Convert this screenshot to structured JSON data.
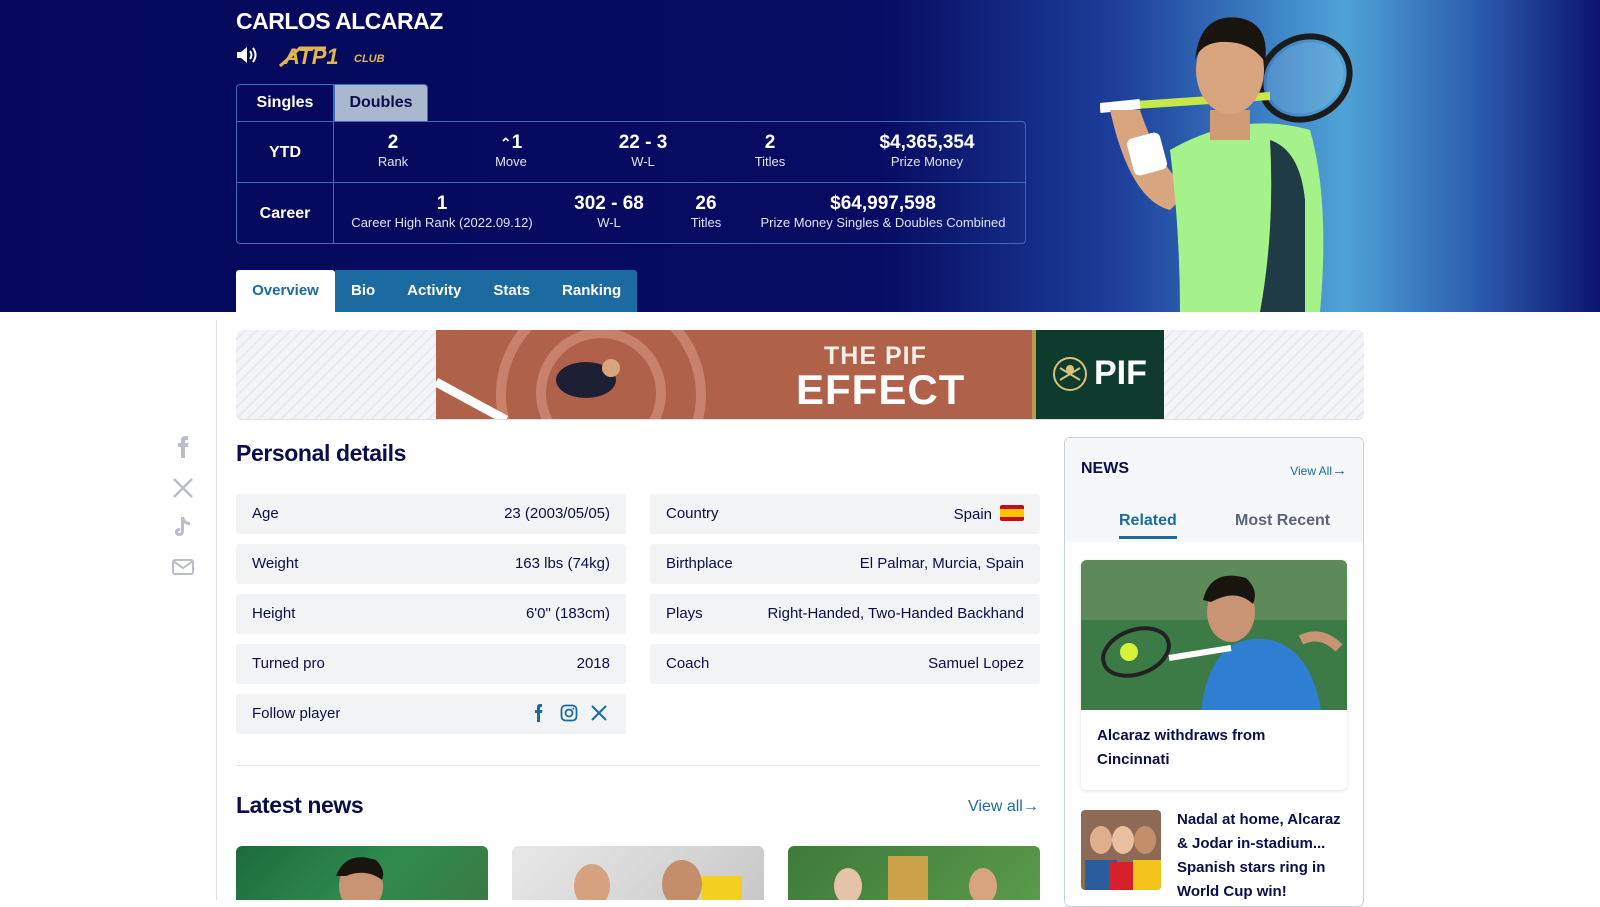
{
  "player": {
    "name": "CARLOS ALCARAZ",
    "badge": "ATP1",
    "badge_suffix": "CLUB"
  },
  "rank_tabs": [
    "Singles",
    "Doubles"
  ],
  "ytd": {
    "label": "YTD",
    "rank": {
      "value": "2",
      "label": "Rank"
    },
    "move": {
      "value": "1",
      "label": "Move"
    },
    "wl": {
      "value": "22 - 3",
      "label": "W-L"
    },
    "titles": {
      "value": "2",
      "label": "Titles"
    },
    "prize": {
      "value": "$4,365,354",
      "label": "Prize Money"
    }
  },
  "career": {
    "label": "Career",
    "high": {
      "value": "1",
      "label": "Career High Rank (2022.09.12)"
    },
    "wl": {
      "value": "302 - 68",
      "label": "W-L"
    },
    "titles": {
      "value": "26",
      "label": "Titles"
    },
    "prize": {
      "value": "$64,997,598",
      "label": "Prize Money Singles & Doubles Combined"
    }
  },
  "nav_tabs": [
    "Overview",
    "Bio",
    "Activity",
    "Stats",
    "Ranking"
  ],
  "ad": {
    "line1": "THE PIF",
    "line2": "EFFECT",
    "brand": "PIF"
  },
  "personal": {
    "title": "Personal details",
    "left": [
      {
        "k": "Age",
        "v": "23 (2003/05/05)"
      },
      {
        "k": "Weight",
        "v": "163 lbs (74kg)"
      },
      {
        "k": "Height",
        "v": "6'0\" (183cm)"
      },
      {
        "k": "Turned pro",
        "v": "2018"
      },
      {
        "k": "Follow player",
        "v": ""
      }
    ],
    "right": [
      {
        "k": "Country",
        "v": "Spain"
      },
      {
        "k": "Birthplace",
        "v": "El Palmar, Murcia, Spain"
      },
      {
        "k": "Plays",
        "v": "Right-Handed, Two-Handed Backhand"
      },
      {
        "k": "Coach",
        "v": "Samuel Lopez"
      }
    ]
  },
  "latest": {
    "title": "Latest news",
    "view_all": "View all"
  },
  "sidebar": {
    "title": "NEWS",
    "view_all": "View All",
    "tabs": [
      "Related",
      "Most Recent"
    ],
    "card_title": "Alcaraz withdraws from Cincinnati",
    "item_title": "Nadal at home, Alcaraz & Jodar in-stadium... Spanish stars ring in World Cup win!"
  },
  "colors": {
    "hero": "#06095b",
    "accent": "#1b6aa0",
    "ad": "#b0614a",
    "pif_green": "#0e3b2e"
  }
}
